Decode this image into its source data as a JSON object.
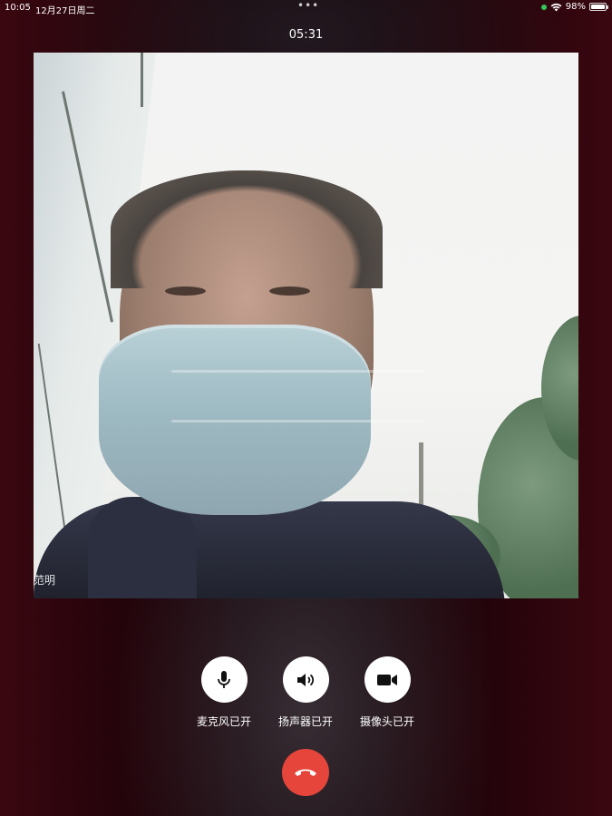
{
  "status_bar": {
    "time": "10:05",
    "date": "12月27日周二",
    "dots": "•••",
    "battery": "98%",
    "battery_level": 0.98,
    "indicator_color": "#34c759"
  },
  "call": {
    "timer": "05:31",
    "caller_name": "范明"
  },
  "controls": {
    "microphone": {
      "label": "麦克风已开",
      "icon": "microphone-icon"
    },
    "speaker": {
      "label": "扬声器已开",
      "icon": "speaker-icon"
    },
    "camera": {
      "label": "摄像头已开",
      "icon": "video-camera-icon"
    },
    "hangup": {
      "icon": "phone-hangup-icon",
      "color": "#e5453b"
    }
  }
}
